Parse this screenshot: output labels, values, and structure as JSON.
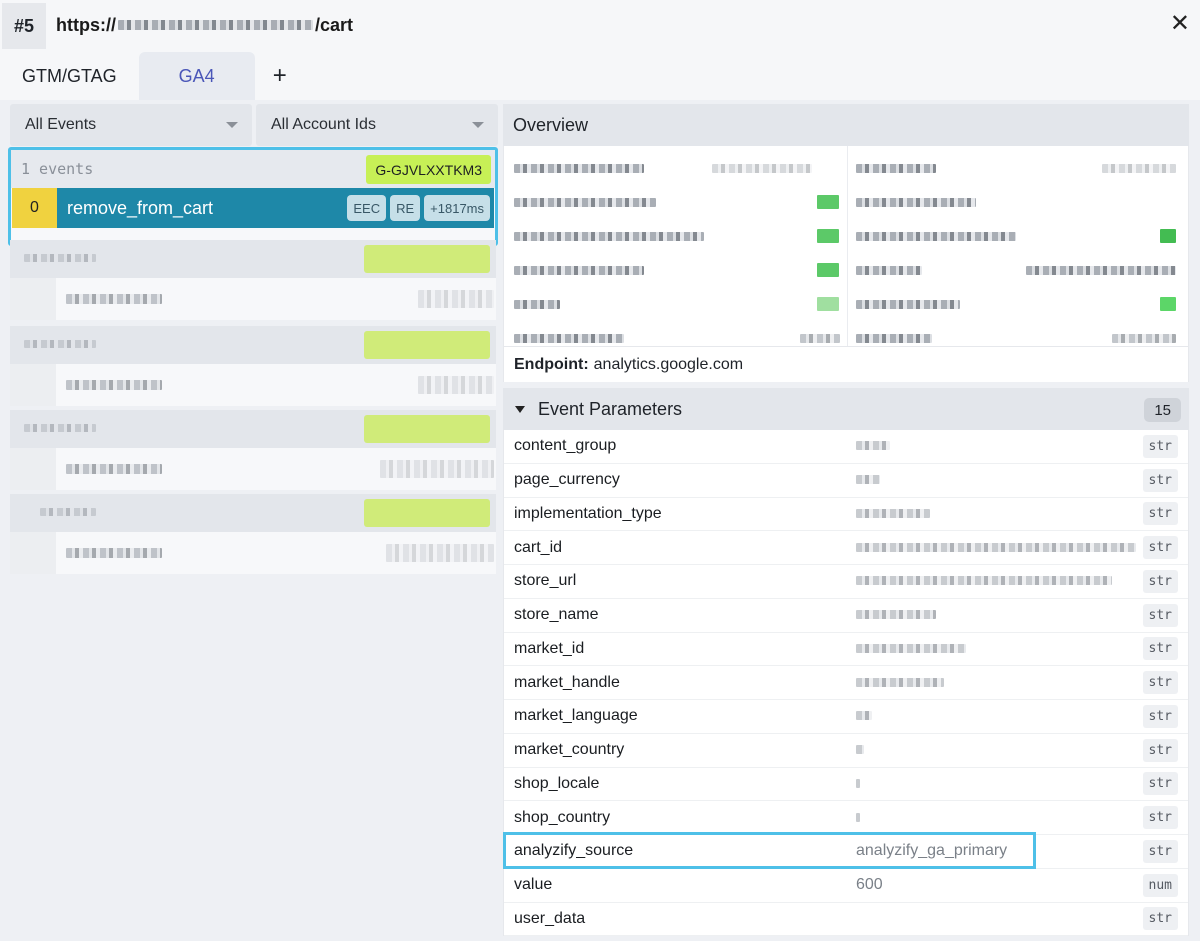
{
  "window": {
    "tab_number": "#5",
    "url_prefix": "https://",
    "url_suffix": "/cart"
  },
  "tabs": [
    {
      "label": "GTM/GTAG",
      "active": false
    },
    {
      "label": "GA4",
      "active": true
    }
  ],
  "tab_add_label": "+",
  "filters": {
    "events": "All Events",
    "accounts": "All Account Ids"
  },
  "event_group": {
    "count_label": "1 events",
    "measurement_id": "G-GJVLXXTKM3",
    "event": {
      "index": "0",
      "name": "remove_from_cart",
      "badges": [
        "EEC",
        "RE",
        "+1817ms"
      ]
    }
  },
  "overview": {
    "title": "Overview",
    "endpoint_label": "Endpoint:",
    "endpoint_value": "analytics.google.com"
  },
  "event_parameters": {
    "title": "Event Parameters",
    "count": "15",
    "rows": [
      {
        "key": "content_group",
        "value": "",
        "type": "str"
      },
      {
        "key": "page_currency",
        "value": "",
        "type": "str"
      },
      {
        "key": "implementation_type",
        "value": "",
        "type": "str"
      },
      {
        "key": "cart_id",
        "value": "",
        "type": "str"
      },
      {
        "key": "store_url",
        "value": "",
        "type": "str"
      },
      {
        "key": "store_name",
        "value": "",
        "type": "str"
      },
      {
        "key": "market_id",
        "value": "",
        "type": "str"
      },
      {
        "key": "market_handle",
        "value": "",
        "type": "str"
      },
      {
        "key": "market_language",
        "value": "",
        "type": "str"
      },
      {
        "key": "market_country",
        "value": "",
        "type": "str"
      },
      {
        "key": "shop_locale",
        "value": "",
        "type": "str"
      },
      {
        "key": "shop_country",
        "value": "",
        "type": "str"
      },
      {
        "key": "analyzify_source",
        "value": "analyzify_ga_primary",
        "type": "str"
      },
      {
        "key": "value",
        "value": "600",
        "type": "num"
      },
      {
        "key": "user_data",
        "value": "",
        "type": "str"
      }
    ]
  },
  "colors": {
    "accent_tab": "#4a56b8",
    "event_row": "#1e88a8",
    "event_index": "#f0d23f",
    "measurement_badge": "#c7f056",
    "highlight": "#4ec0e8"
  }
}
